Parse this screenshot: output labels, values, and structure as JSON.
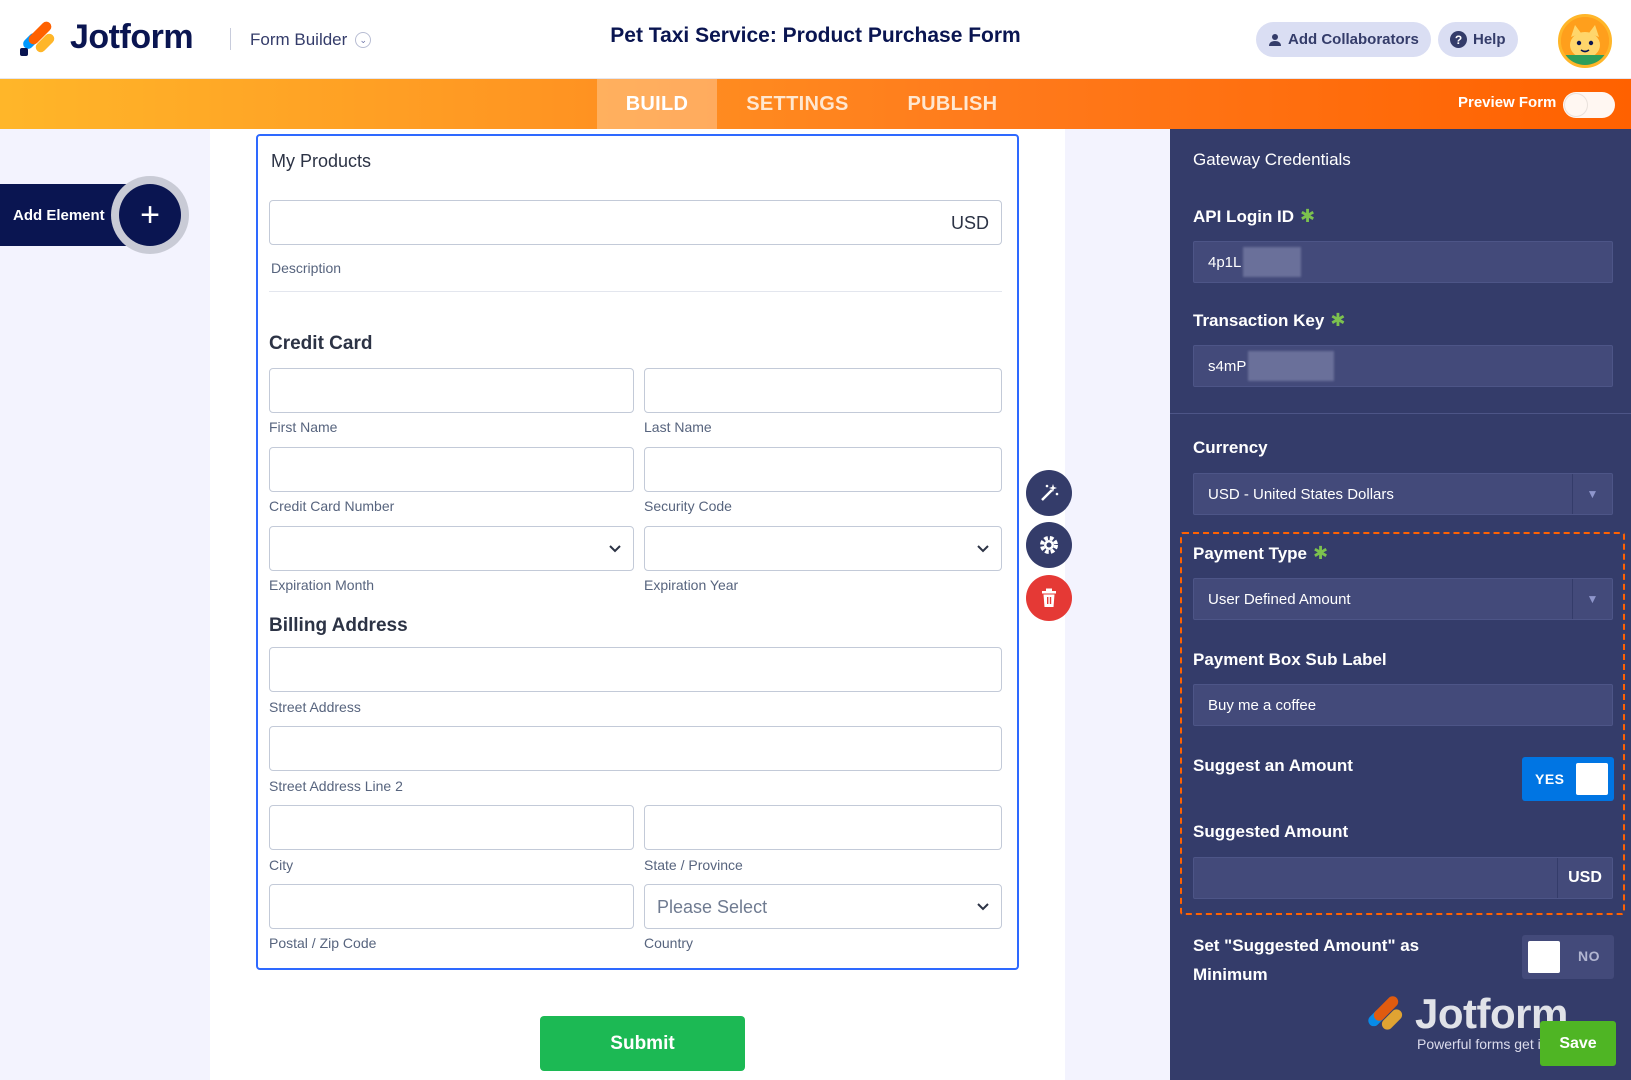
{
  "header": {
    "logo_text": "Jotform",
    "builder_label": "Form Builder",
    "form_title": "Pet Taxi Service: Product Purchase Form",
    "collaborators_label": "Add Collaborators",
    "help_label": "Help"
  },
  "tabs": {
    "build": "BUILD",
    "settings": "SETTINGS",
    "publish": "PUBLISH",
    "active": "BUILD"
  },
  "preview_label": "Preview Form",
  "add_element_label": "Add Element",
  "form": {
    "products_title": "My Products",
    "amount_currency": "USD",
    "description_label": "Description",
    "credit_card_title": "Credit Card",
    "first_name": "First Name",
    "last_name": "Last Name",
    "card_number": "Credit Card Number",
    "security_code": "Security Code",
    "exp_month": "Expiration Month",
    "exp_year": "Expiration Year",
    "billing_title": "Billing Address",
    "street": "Street Address",
    "street2": "Street Address Line 2",
    "city": "City",
    "state": "State / Province",
    "postal": "Postal / Zip Code",
    "country": "Country",
    "country_placeholder": "Please Select",
    "submit_label": "Submit"
  },
  "panel": {
    "section_title": "Gateway Credentials",
    "api_login_label": "API Login ID",
    "api_login_value": "4p1L",
    "transaction_key_label": "Transaction Key",
    "transaction_key_value": "s4mP",
    "currency_label": "Currency",
    "currency_value": "USD - United States Dollars",
    "payment_type_label": "Payment Type",
    "payment_type_value": "User Defined Amount",
    "sub_label_label": "Payment Box Sub Label",
    "sub_label_value": "Buy me a coffee",
    "suggest_label": "Suggest an Amount",
    "suggest_toggle": "YES",
    "suggested_amount_label": "Suggested Amount",
    "suggested_currency": "USD",
    "minimum_label": "Set \"Suggested Amount\" as Minimum",
    "minimum_toggle": "NO",
    "save_label": "Save"
  },
  "watermark": {
    "brand": "Jotform",
    "tagline": "Powerful forms get it done."
  },
  "colors": {
    "navy": "#0a1551",
    "orange": "#ff6100",
    "panel": "#343c6a",
    "accent_blue": "#2e69ff",
    "submit_green": "#1cb954"
  }
}
